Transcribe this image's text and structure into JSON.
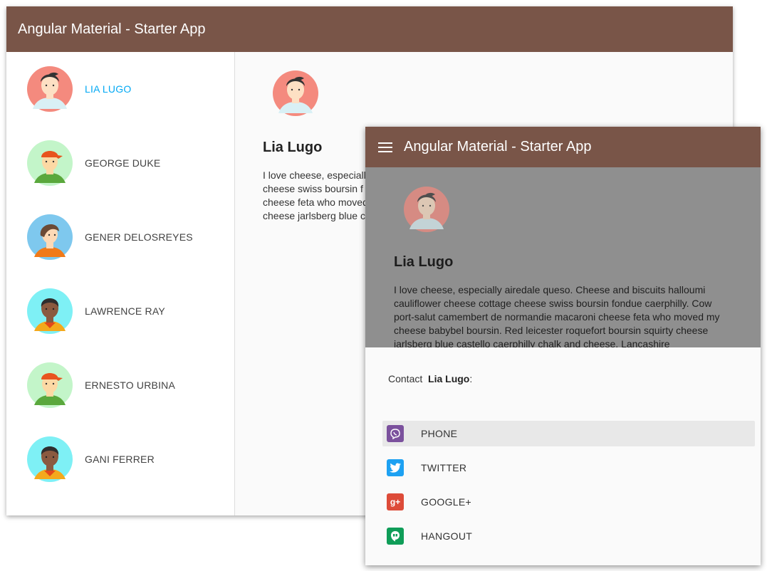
{
  "app_title": "Angular Material - Starter App",
  "users": [
    {
      "name": "LIA LUGO",
      "selected": true
    },
    {
      "name": "GEORGE DUKE",
      "selected": false
    },
    {
      "name": "GENER DELOSREYES",
      "selected": false
    },
    {
      "name": "LAWRENCE RAY",
      "selected": false
    },
    {
      "name": "ERNESTO URBINA",
      "selected": false
    },
    {
      "name": "GANI FERRER",
      "selected": false
    }
  ],
  "selected_user": {
    "name": "Lia Lugo",
    "bio_truncated": [
      "I love cheese, especiall",
      "cheese swiss boursin f",
      "cheese feta who moved",
      "cheese jarlsberg blue c"
    ],
    "bio_lines": [
      "I love cheese, especially airedale queso. Cheese and biscuits halloumi",
      "cauliflower cheese cottage cheese swiss boursin fondue caerphilly. Cow",
      "port-salut camembert de normandie macaroni cheese feta who moved my",
      "cheese babybel boursin. Red leicester roquefort boursin squirty cheese",
      "jarlsberg blue castello caerphilly chalk and cheese. Lancashire"
    ]
  },
  "contact_sheet": {
    "prefix": "Contact",
    "name": "Lia Lugo",
    "suffix": ":",
    "actions": [
      {
        "label": "PHONE",
        "icon": "viber-icon",
        "color": "#7b519d",
        "highlight": true
      },
      {
        "label": "TWITTER",
        "icon": "twitter-icon",
        "color": "#1da1f2",
        "highlight": false
      },
      {
        "label": "GOOGLE+",
        "icon": "google-plus-icon",
        "color": "#dd4b39",
        "highlight": false
      },
      {
        "label": "HANGOUT",
        "icon": "hangout-icon",
        "color": "#0f9d58",
        "highlight": false
      }
    ]
  },
  "colors": {
    "toolbar": "#795548",
    "accent": "#03a9f4"
  }
}
